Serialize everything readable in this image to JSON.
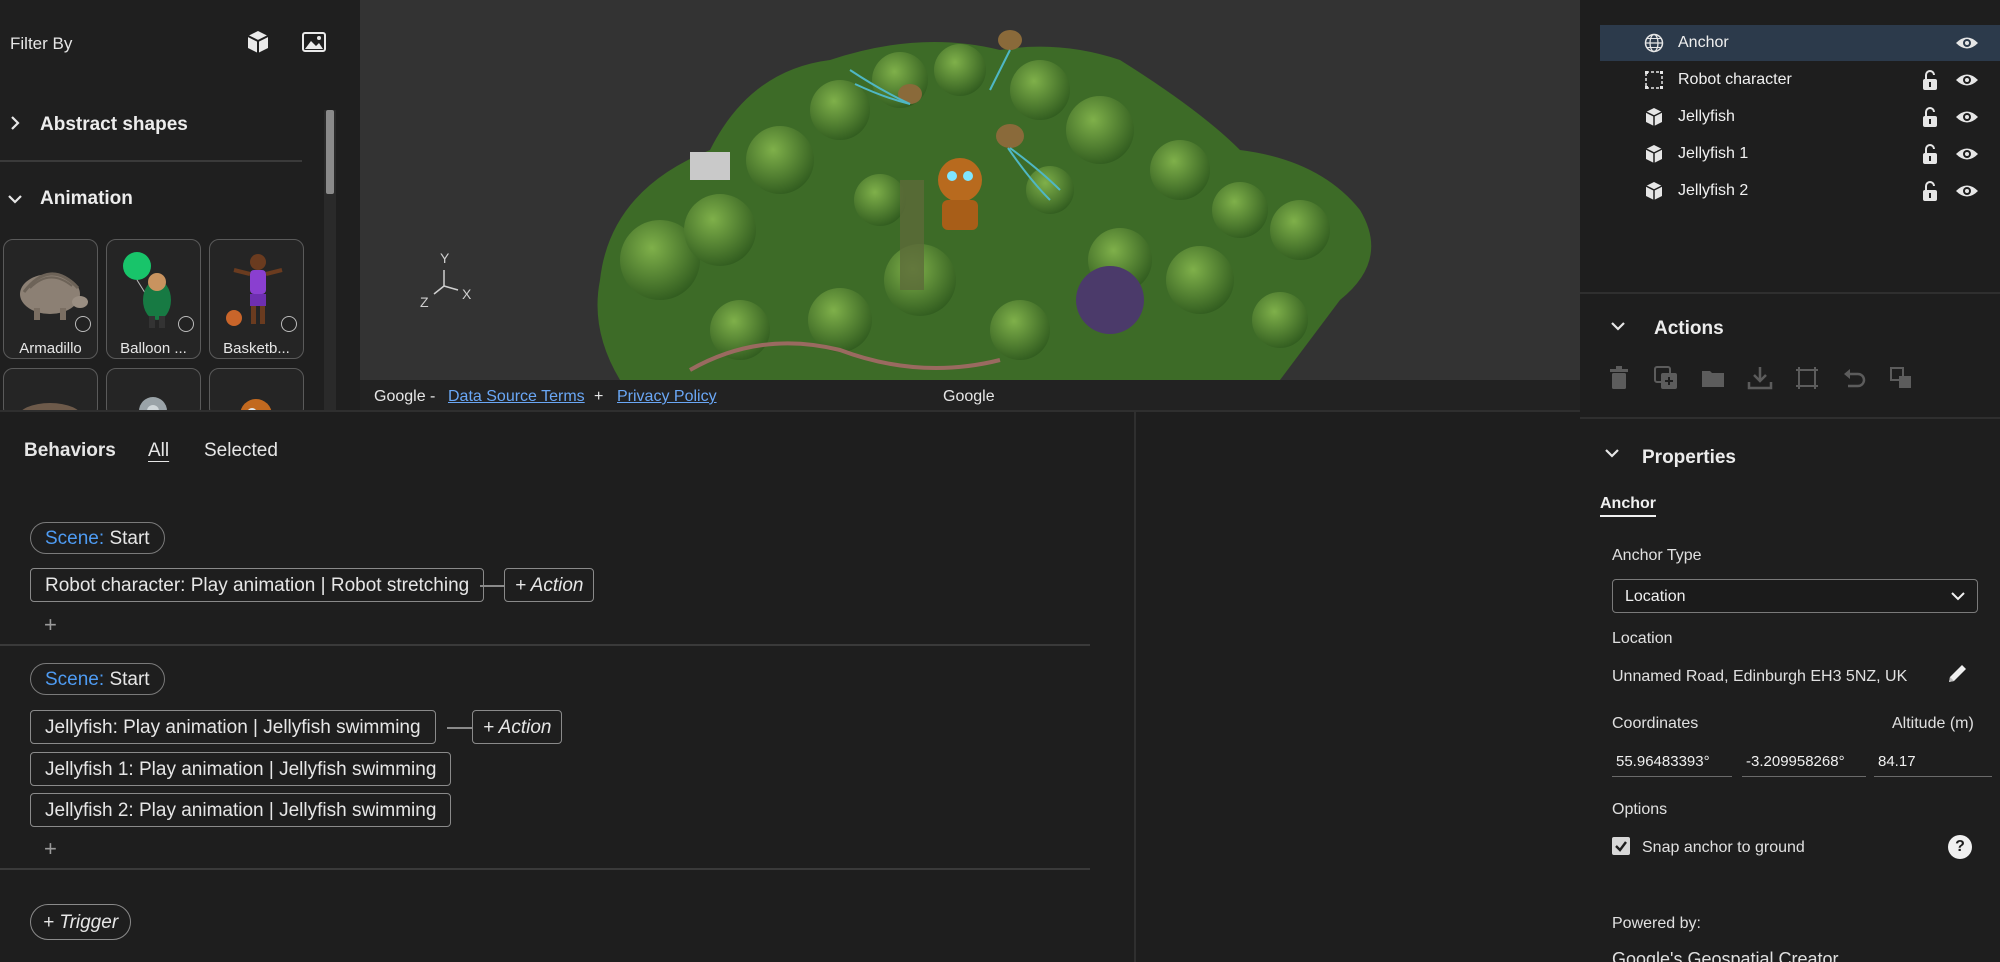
{
  "asset_panel": {
    "filter_label": "Filter By",
    "filter_icons": [
      "cube-icon",
      "image-icon"
    ],
    "categories": [
      {
        "label": "Abstract shapes",
        "expanded": false
      },
      {
        "label": "Animation",
        "expanded": true
      }
    ],
    "assets": [
      {
        "label": "Armadillo"
      },
      {
        "label": "Balloon ..."
      },
      {
        "label": "Basketb..."
      }
    ]
  },
  "viewport": {
    "axes": {
      "y": "Y",
      "z": "Z",
      "x": "X"
    },
    "attribution": {
      "prefix": "Google - ",
      "data_source_terms": "Data Source Terms",
      "plus": "+",
      "privacy_policy": "Privacy Policy",
      "center": "Google"
    }
  },
  "scene_tree": {
    "items": [
      {
        "label": "Anchor",
        "icon": "globe-icon",
        "selected": true,
        "locked": false
      },
      {
        "label": "Robot character",
        "icon": "bounding-box-icon",
        "selected": false,
        "locked": true
      },
      {
        "label": "Jellyfish",
        "icon": "cube-icon",
        "selected": false,
        "locked": true
      },
      {
        "label": "Jellyfish 1",
        "icon": "cube-icon",
        "selected": false,
        "locked": true
      },
      {
        "label": "Jellyfish 2",
        "icon": "cube-icon",
        "selected": false,
        "locked": true
      }
    ]
  },
  "actions": {
    "title": "Actions",
    "icons": [
      "trash-icon",
      "duplicate-icon",
      "folder-icon",
      "download-icon",
      "frame-icon",
      "undo-icon",
      "replace-icon"
    ]
  },
  "properties": {
    "title": "Properties",
    "tab": "Anchor",
    "anchor_type_label": "Anchor Type",
    "anchor_type_value": "Location",
    "location_label": "Location",
    "location_value": "Unnamed Road, Edinburgh EH3 5NZ, UK",
    "coordinates_label": "Coordinates",
    "altitude_label": "Altitude (m)",
    "latitude": "55.96483393°",
    "longitude": "-3.209958268°",
    "altitude": "84.17",
    "options_label": "Options",
    "snap_label": "Snap anchor to ground",
    "snap_checked": true,
    "powered_by": "Powered by:",
    "powered_by_name": "Google's Geospatial Creator"
  },
  "behaviors": {
    "title": "Behaviors",
    "tabs": [
      "All",
      "Selected"
    ],
    "groups": [
      {
        "trigger": {
          "scene": "Scene:",
          "event": "Start"
        },
        "actions": [
          "Robot character: Play animation | Robot stretching"
        ],
        "add_action": "+ Action"
      },
      {
        "trigger": {
          "scene": "Scene:",
          "event": "Start"
        },
        "actions": [
          "Jellyfish: Play animation | Jellyfish swimming",
          "Jellyfish 1: Play animation | Jellyfish swimming",
          "Jellyfish 2: Play animation | Jellyfish swimming"
        ],
        "add_action": "+ Action"
      }
    ],
    "plus": "+",
    "add_trigger": "+ Trigger"
  }
}
